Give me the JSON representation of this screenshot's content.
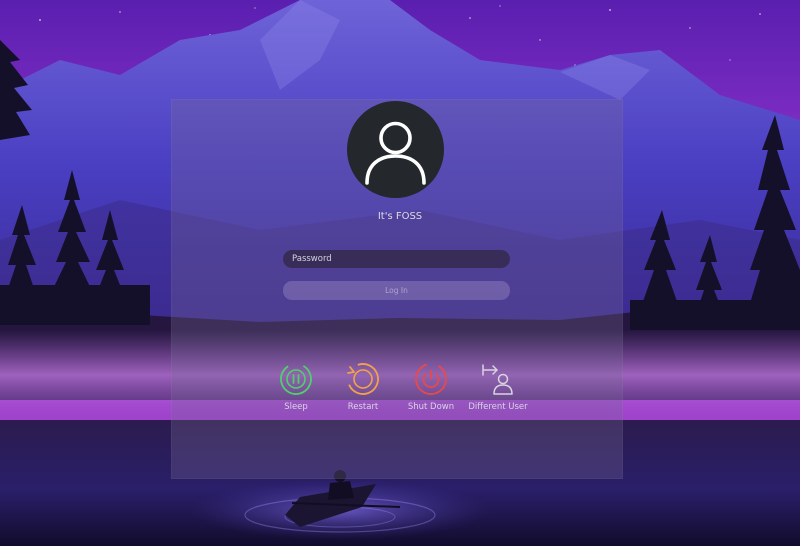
{
  "user": {
    "display_name": "It's FOSS"
  },
  "login": {
    "password_placeholder": "Password",
    "login_label": "Log In"
  },
  "actions": [
    {
      "label": "Sleep",
      "icon": "sleep-icon",
      "color": "#4fd16a"
    },
    {
      "label": "Restart",
      "icon": "restart-icon",
      "color": "#f2a24a"
    },
    {
      "label": "Shut Down",
      "icon": "power-icon",
      "color": "#e8494a"
    },
    {
      "label": "Different User",
      "icon": "switch-user-icon",
      "color": "#d8d4e2"
    }
  ]
}
